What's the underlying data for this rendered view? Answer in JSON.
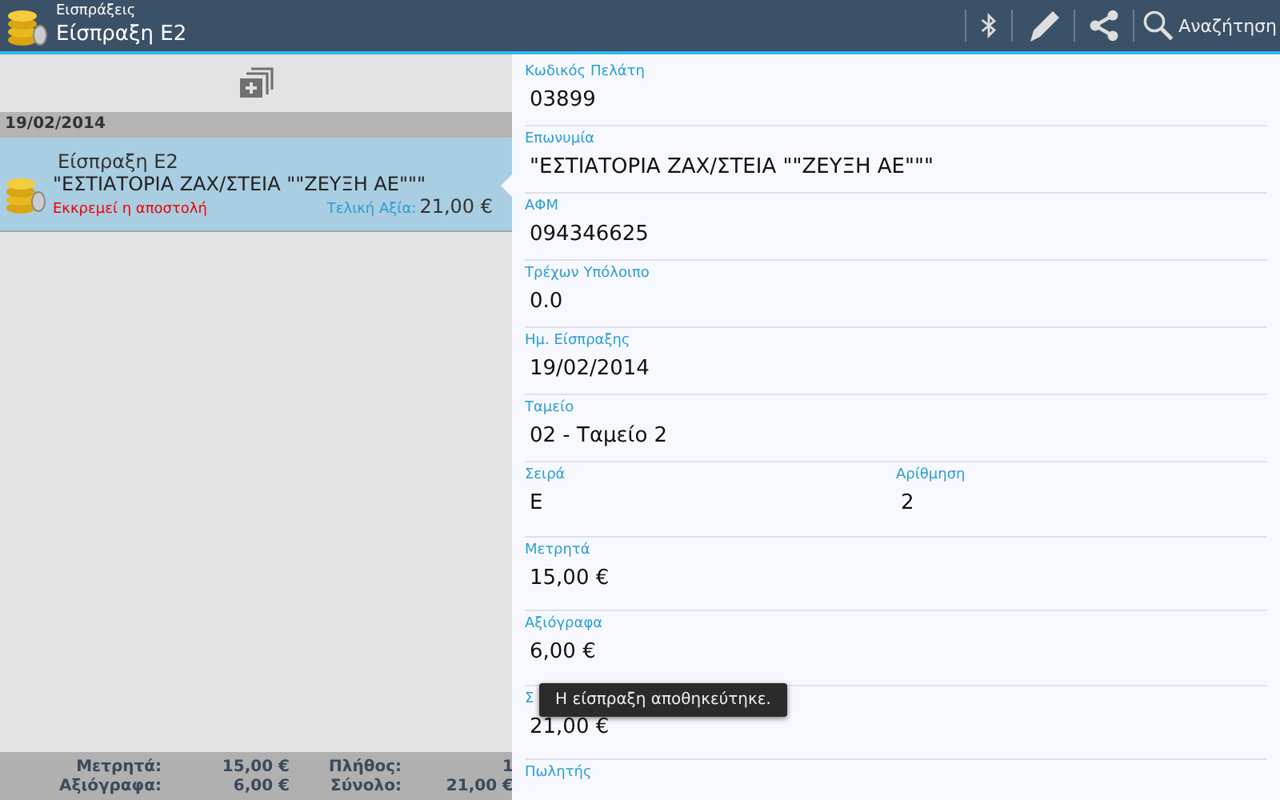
{
  "header": {
    "subtitle": "Εισπράξεις",
    "title": "Είσπραξη Ε2",
    "search_label": "Αναζήτηση"
  },
  "list": {
    "groups": [
      {
        "date": "19/02/2014",
        "items": [
          {
            "title": "Είσπραξη Ε2",
            "customer": "\"ΕΣΤΙΑΤΟΡΙΑ ΖΑΧ/ΣΤΕΙΑ \"\"ΖΕΥΞΗ ΑΕ\"\"\"",
            "status": "Εκκρεμεί η αποστολή",
            "total_label": "Τελική Αξία:",
            "total": "21,00 €",
            "selected": true
          }
        ]
      }
    ]
  },
  "summary": [
    {
      "label": "Μετρητά:",
      "value": "15,00 €"
    },
    {
      "label": "Πλήθος:",
      "value": "1"
    },
    {
      "label": "Αξιόγραφα:",
      "value": "6,00 €"
    },
    {
      "label": "Σύνολο:",
      "value": "21,00 €"
    }
  ],
  "details": [
    {
      "fields": [
        {
          "label": "Κωδικός Πελάτη",
          "value": "03899"
        }
      ]
    },
    {
      "fields": [
        {
          "label": "Επωνυμία",
          "value": "\"ΕΣΤΙΑΤΟΡΙΑ ΖΑΧ/ΣΤΕΙΑ \"\"ΖΕΥΞΗ ΑΕ\"\"\""
        }
      ]
    },
    {
      "fields": [
        {
          "label": "ΑΦΜ",
          "value": "094346625"
        }
      ]
    },
    {
      "fields": [
        {
          "label": "Τρέχων Υπόλοιπο",
          "value": "0.0"
        }
      ]
    },
    {
      "fields": [
        {
          "label": "Ημ. Είσπραξης",
          "value": "19/02/2014"
        }
      ]
    },
    {
      "fields": [
        {
          "label": "Ταμείο",
          "value": "02 - Ταμείο 2"
        }
      ]
    },
    {
      "fields": [
        {
          "label": "Σειρά",
          "value": "Ε"
        },
        {
          "label": "Αρίθμηση",
          "value": "2"
        }
      ]
    },
    {
      "fields": [
        {
          "label": "Μετρητά",
          "value": "15,00 €"
        }
      ]
    },
    {
      "fields": [
        {
          "label": "Αξιόγραφα",
          "value": "6,00 €"
        }
      ]
    },
    {
      "fields": [
        {
          "label": "Σ",
          "value": "21,00 €"
        }
      ]
    },
    {
      "fields": [
        {
          "label": "Πωλητής"
        }
      ]
    }
  ],
  "toast": "Η είσπραξη αποθηκεύτηκε."
}
